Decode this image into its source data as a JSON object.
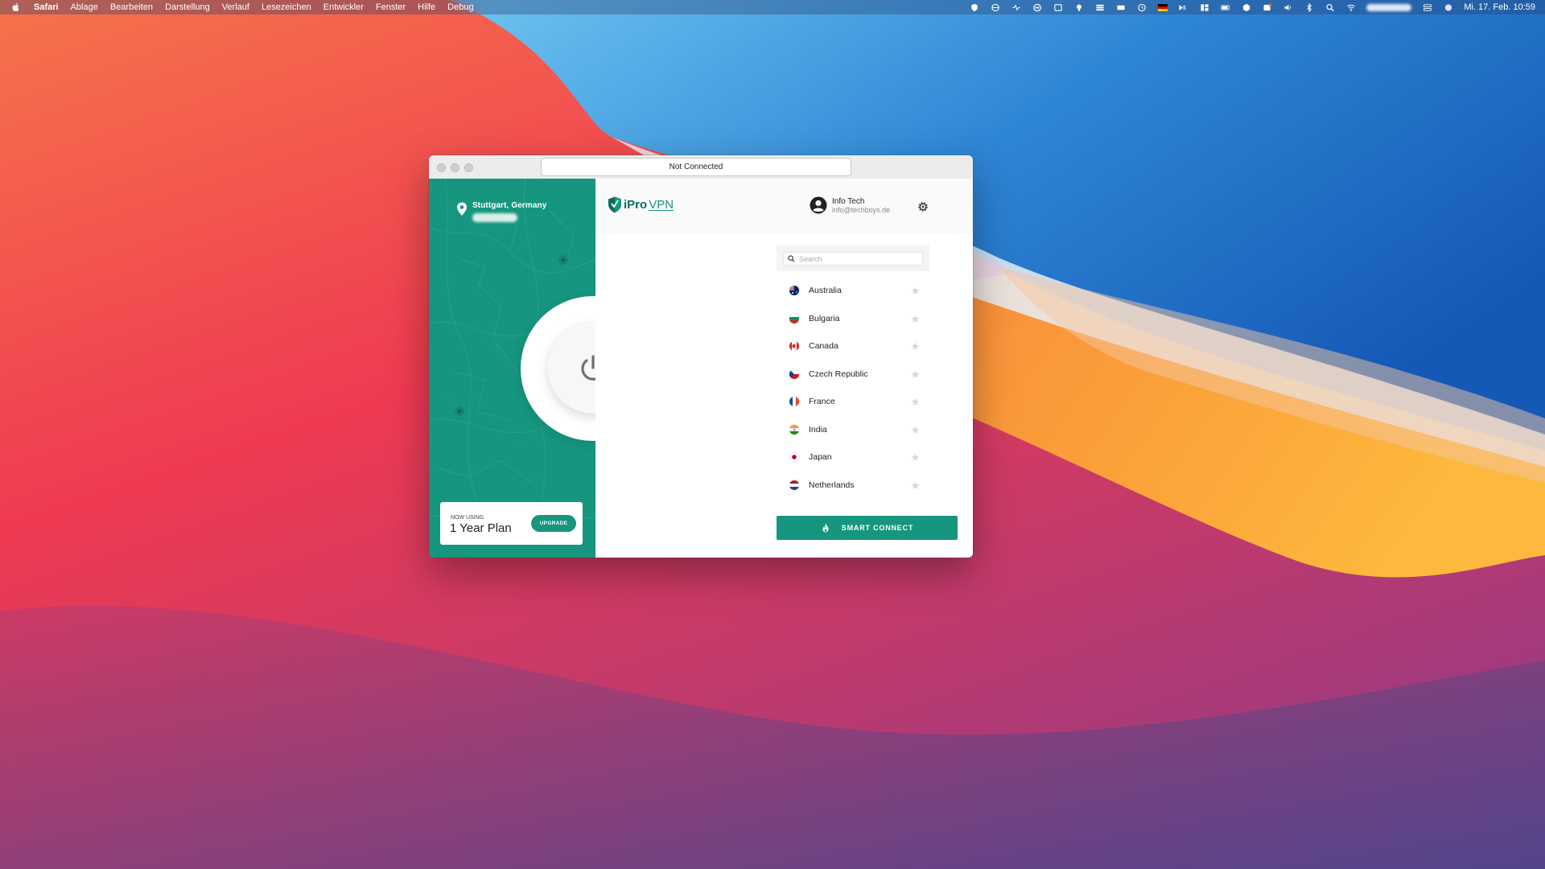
{
  "menubar": {
    "app_name": "Safari",
    "items": [
      "Ablage",
      "Bearbeiten",
      "Darstellung",
      "Verlauf",
      "Lesezeichen",
      "Entwickler",
      "Fenster",
      "Hilfe",
      "Debug"
    ],
    "clock": "Mi. 17. Feb. 10:59"
  },
  "window": {
    "title": "Not Connected"
  },
  "location": {
    "city": "Stuttgart, Germany"
  },
  "plan": {
    "caption": "NOW USING",
    "name": "1 Year Plan",
    "upgrade_label": "UPGRADE"
  },
  "header": {
    "brand_part1": "iPro",
    "brand_part2": "VPN",
    "user_name": "Info Tech",
    "user_email": "info@techboys.de"
  },
  "search": {
    "placeholder": "Search",
    "value": ""
  },
  "servers": [
    {
      "name": "Australia",
      "flag": "australia-flag-icon"
    },
    {
      "name": "Bulgaria",
      "flag": "bulgaria-flag-icon"
    },
    {
      "name": "Canada",
      "flag": "canada-flag-icon"
    },
    {
      "name": "Czech Republic",
      "flag": "czech-republic-flag-icon"
    },
    {
      "name": "France",
      "flag": "france-flag-icon"
    },
    {
      "name": "India",
      "flag": "india-flag-icon"
    },
    {
      "name": "Japan",
      "flag": "japan-flag-icon"
    },
    {
      "name": "Netherlands",
      "flag": "netherlands-flag-icon"
    }
  ],
  "smart_connect_label": "SMART CONNECT",
  "colors": {
    "accent": "#16967f",
    "accent_dark": "#0e6b5c"
  }
}
